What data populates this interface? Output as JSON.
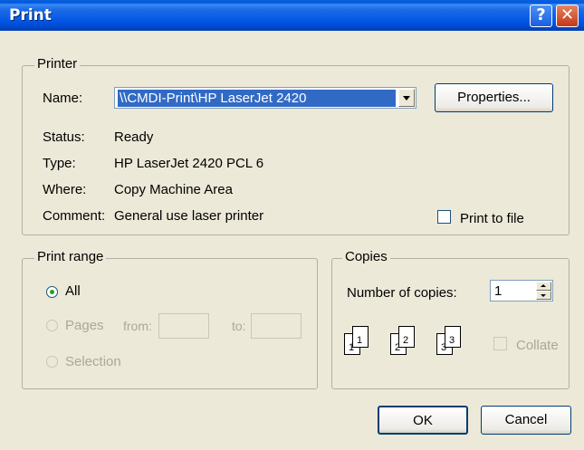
{
  "window": {
    "title": "Print",
    "help_glyph": "?",
    "close_glyph": "✕"
  },
  "printer": {
    "legend": "Printer",
    "name_label": "Name:",
    "name_value": "\\\\CMDI-Print\\HP LaserJet 2420",
    "properties_label": "Properties...",
    "status_label": "Status:",
    "status_value": "Ready",
    "type_label": "Type:",
    "type_value": "HP LaserJet 2420 PCL 6",
    "where_label": "Where:",
    "where_value": "Copy Machine Area",
    "comment_label": "Comment:",
    "comment_value": "General use laser printer",
    "print_to_file_label": "Print to file",
    "print_to_file_checked": false
  },
  "print_range": {
    "legend": "Print range",
    "all_label": "All",
    "pages_label": "Pages",
    "from_label": "from:",
    "to_label": "to:",
    "selection_label": "Selection",
    "selected": "All"
  },
  "copies": {
    "legend": "Copies",
    "number_label": "Number of copies:",
    "number_value": "1",
    "collate_label": "Collate",
    "collate_checked": false,
    "pages": [
      "1",
      "1",
      "2",
      "2",
      "3",
      "3"
    ]
  },
  "buttons": {
    "ok": "OK",
    "cancel": "Cancel"
  },
  "colors": {
    "titlebar": "#0055e5",
    "selection": "#316ac5",
    "dialog_bg": "#ece9d8"
  }
}
